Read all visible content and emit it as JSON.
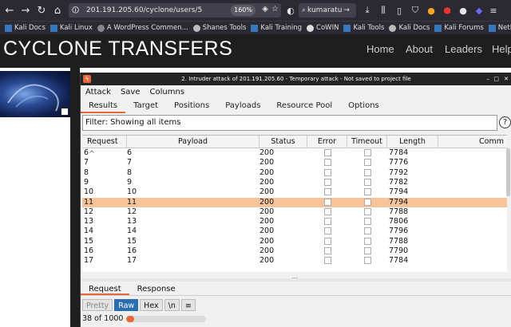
{
  "browser": {
    "url": "201.191.205.60/cyclone/users/5",
    "zoom": "160%",
    "search": "kumaratu",
    "bookmarks": [
      "Kali Docs",
      "Kali Linux",
      "A WordPress Commen...",
      "Shanes Tools",
      "Kali Training",
      "CoWIN",
      "Kali Tools",
      "Kali Docs",
      "Kali Forums",
      "NetHunter"
    ]
  },
  "site": {
    "title": "CYCLONE TRANSFERS",
    "nav": [
      "Home",
      "About",
      "Leaders",
      "Help"
    ]
  },
  "burp": {
    "window_title": "2. Intruder attack of 201.191.205.60 - Temporary attack - Not saved to project file",
    "menu": [
      "Attack",
      "Save",
      "Columns"
    ],
    "tabs": [
      "Results",
      "Target",
      "Positions",
      "Payloads",
      "Resource Pool",
      "Options"
    ],
    "active_tab": "Results",
    "filter": "Filter: Showing all items",
    "help": "?",
    "columns": [
      "Request",
      "Payload",
      "Status",
      "Error",
      "Timeout",
      "Length",
      "Comm"
    ],
    "sort_indicator": "^",
    "rows": [
      {
        "request": "6",
        "payload": "6",
        "status": "200",
        "length": "7784"
      },
      {
        "request": "7",
        "payload": "7",
        "status": "200",
        "length": "7776"
      },
      {
        "request": "8",
        "payload": "8",
        "status": "200",
        "length": "7792"
      },
      {
        "request": "9",
        "payload": "9",
        "status": "200",
        "length": "7782"
      },
      {
        "request": "10",
        "payload": "10",
        "status": "200",
        "length": "7794"
      },
      {
        "request": "11",
        "payload": "11",
        "status": "200",
        "length": "7794"
      },
      {
        "request": "12",
        "payload": "12",
        "status": "200",
        "length": "7788"
      },
      {
        "request": "13",
        "payload": "13",
        "status": "200",
        "length": "7806"
      },
      {
        "request": "14",
        "payload": "14",
        "status": "200",
        "length": "7796"
      },
      {
        "request": "15",
        "payload": "15",
        "status": "200",
        "length": "7788"
      },
      {
        "request": "16",
        "payload": "16",
        "status": "200",
        "length": "7790"
      },
      {
        "request": "17",
        "payload": "17",
        "status": "200",
        "length": "7784"
      }
    ],
    "selected_row": 5,
    "detail_tabs": [
      "Request",
      "Response"
    ],
    "view_buttons": [
      "Pretty",
      "Raw",
      "Hex",
      "\\n",
      "≡"
    ],
    "active_view": "Raw",
    "status_text": "38 of 1000",
    "progress_fraction": 0.038,
    "accent_color": "#e8673a",
    "selection_color": "#f7c39b"
  }
}
